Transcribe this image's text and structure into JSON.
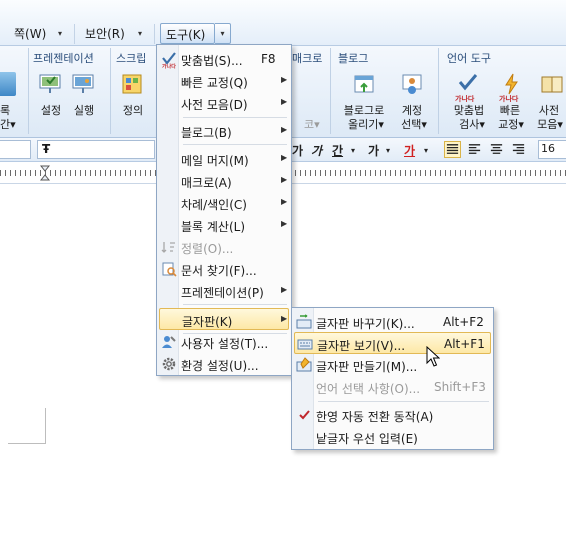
{
  "menubar": {
    "item1": "쪽(W)",
    "item2": "보안(R)",
    "item3": "도구(K)"
  },
  "ribbon": {
    "groups": {
      "presentation": "프레젠테이션",
      "script": "스크립",
      "macro": "매크로",
      "blog": "블로그",
      "language": "언어 도구"
    },
    "left_labels": [
      "록",
      "간▾"
    ],
    "buttons": {
      "setup": "설정",
      "run": "실행",
      "define": "정의",
      "macro_sub": "코▾",
      "blog_post_line1": "블로그로",
      "blog_post_line2": "올리기▾",
      "account_line1": "계정",
      "account_line2": "선택▾",
      "spell_line1": "맞춤법",
      "spell_line2": "검사▾",
      "quick_line1": "빠른",
      "quick_line2": "교정▾",
      "dict_line1": "사전",
      "dict_line2": "모음▾"
    },
    "icon_text": {
      "spell": "가나다",
      "quick": "가나다"
    }
  },
  "formatbar": {
    "font_glyph": "Ŧ",
    "styles": [
      "가",
      "가",
      "간"
    ],
    "color_text": "가",
    "font_size": "16"
  },
  "tools_menu": {
    "items": [
      {
        "label": "맞춤법(S)...",
        "shortcut": "F8"
      },
      {
        "label": "빠른 교정(Q)"
      },
      {
        "label": "사전 모음(D)"
      },
      {
        "label": "블로그(B)"
      },
      {
        "label": "메일 머지(M)"
      },
      {
        "label": "매크로(A)"
      },
      {
        "label": "차례/색인(C)"
      },
      {
        "label": "블록 계산(L)"
      },
      {
        "label": "정렬(O)..."
      },
      {
        "label": "문서 찾기(F)..."
      },
      {
        "label": "프레젠테이션(P)"
      },
      {
        "label": "글자판(K)"
      },
      {
        "label": "사용자 설정(T)..."
      },
      {
        "label": "환경 설정(U)..."
      }
    ],
    "spell_icon_text": "가나다"
  },
  "keyboard_submenu": {
    "items": [
      {
        "label": "글자판 바꾸기(K)...",
        "shortcut": "Alt+F2"
      },
      {
        "label": "글자판 보기(V)...",
        "shortcut": "Alt+F1"
      },
      {
        "label": "글자판 만들기(M)..."
      },
      {
        "label": "언어 선택 사항(O)...",
        "shortcut": "Shift+F3"
      },
      {
        "label": "한영 자동 전환 동작(A)"
      },
      {
        "label": "낱글자 우선 입력(E)"
      }
    ]
  },
  "colors": {
    "accent": "#e2b955",
    "highlight": "#fde8a6",
    "check": "#c0282d",
    "group_title": "#2a4d7a"
  }
}
